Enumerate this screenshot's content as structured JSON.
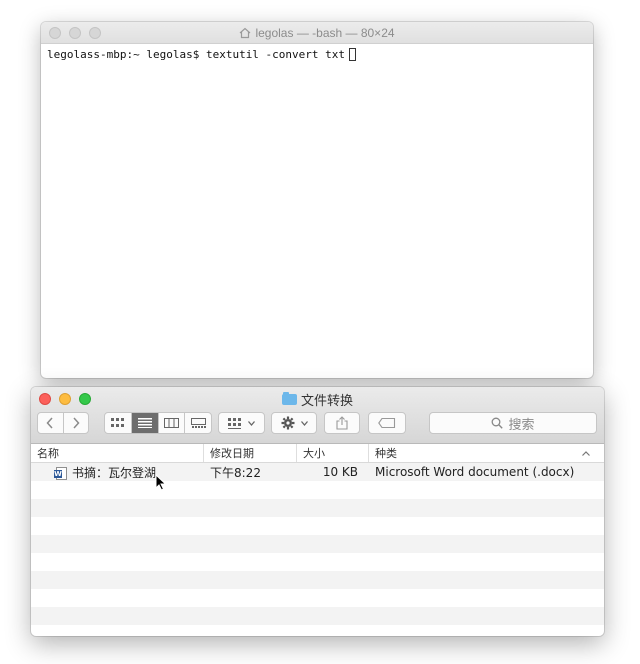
{
  "terminal": {
    "title": "legolas — -bash — 80×24",
    "prompt": "legolass-mbp:~ legolas$",
    "command": "textutil -convert txt"
  },
  "finder": {
    "title": "文件转换",
    "search_placeholder": "搜索",
    "columns": [
      "名称",
      "修改日期",
      "大小",
      "种类"
    ],
    "files": [
      {
        "name": "书摘：瓦尔登湖",
        "modified": "下午8:22",
        "size": "10 KB",
        "kind": "Microsoft Word document (.docx)"
      }
    ]
  },
  "icons": {
    "terminal_title": "house-icon",
    "finder_title": "folder-icon",
    "file": "word-document-icon",
    "search": "magnifier-icon",
    "sort": "chevron-up-icon"
  },
  "colors": {
    "close": "#fc605b",
    "minimize": "#fdbc40",
    "maximize": "#34c84a",
    "folder": "#6cb7ea"
  }
}
